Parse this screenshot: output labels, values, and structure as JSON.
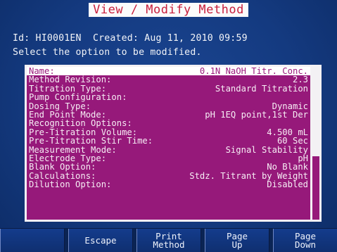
{
  "header": {
    "title": "View / Modify Method",
    "info_line": "Id: HI0001EN  Created: Aug 11, 2010 09:59",
    "instruction": "Select the option to be modified."
  },
  "options": [
    {
      "label": "Name:",
      "value": "0.1N NaOH Titr. Conc."
    },
    {
      "label": "Method Revision:",
      "value": "2.3"
    },
    {
      "label": "Titration Type:",
      "value": "Standard Titration"
    },
    {
      "label": "Pump Configuration:",
      "value": ""
    },
    {
      "label": "Dosing Type:",
      "value": "Dynamic"
    },
    {
      "label": "End Point Mode:",
      "value": "pH 1EQ point,1st Der"
    },
    {
      "label": "Recognition Options:",
      "value": ""
    },
    {
      "label": "Pre-Titration Volume:",
      "value": "4.500 mL"
    },
    {
      "label": "Pre-Titration Stir Time:",
      "value": "60 Sec"
    },
    {
      "label": "Measurement Mode:",
      "value": "Signal Stability"
    },
    {
      "label": "Electrode Type:",
      "value": "pH"
    },
    {
      "label": "Blank Option:",
      "value": "No Blank"
    },
    {
      "label": "Calculations:",
      "value": "Stdz. Titrant by Weight"
    },
    {
      "label": "Dilution Option:",
      "value": "Disabled"
    }
  ],
  "softkeys": [
    {
      "label": "",
      "line2": ""
    },
    {
      "label": "Escape",
      "line2": ""
    },
    {
      "label": "Print",
      "line2": "Method"
    },
    {
      "label": "Page",
      "line2": "Up"
    },
    {
      "label": "Page",
      "line2": "Down"
    }
  ],
  "colors": {
    "background": "#143a80",
    "list_bg": "#96197a",
    "title_text": "#c81e3c"
  }
}
